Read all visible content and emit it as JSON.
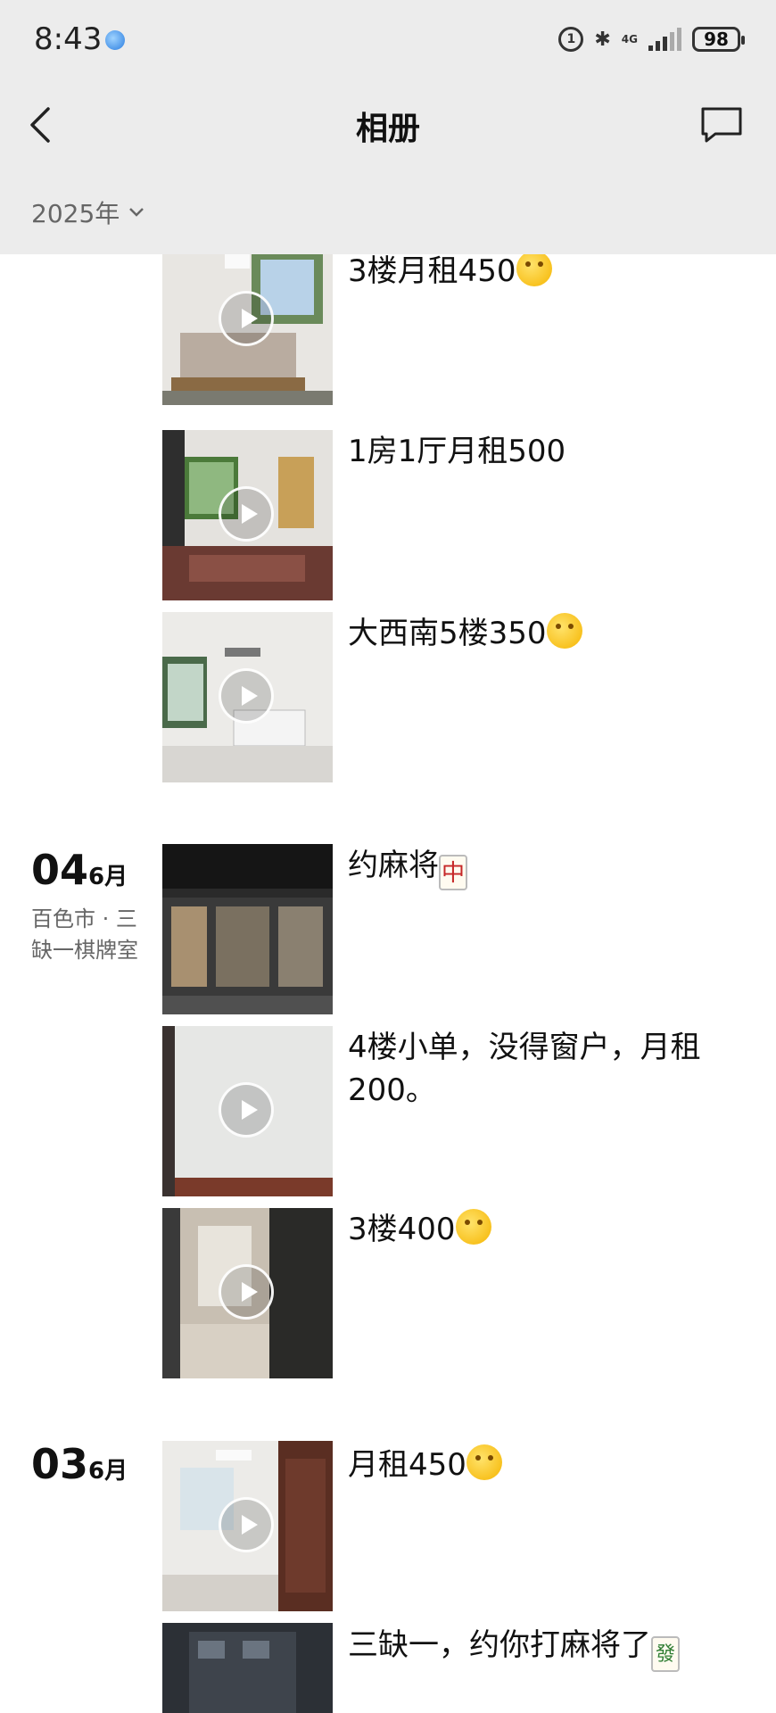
{
  "status_bar": {
    "time": "8:43",
    "battery": "98",
    "network": "4G"
  },
  "header": {
    "title": "相册",
    "year_filter": "2025年"
  },
  "groups": [
    {
      "posts": [
        {
          "text": "3楼月租450",
          "emoji": "smirk-emoji",
          "video": true
        },
        {
          "text": "1房1厅月租500",
          "video": true
        },
        {
          "text": "大西南5楼350",
          "emoji": "smirk-emoji",
          "video": true
        }
      ]
    },
    {
      "day": "04",
      "month": "6月",
      "location": "百色市 · 三缺一棋牌室",
      "posts": [
        {
          "text": "约麻将",
          "tile": "中",
          "video": false
        },
        {
          "text": "4楼小单，没得窗户，月租200。",
          "video": true
        },
        {
          "text": "3楼400",
          "emoji": "smirk-emoji",
          "video": true
        }
      ]
    },
    {
      "day": "03",
      "month": "6月",
      "posts": [
        {
          "text": "月租450",
          "emoji": "smirk-emoji",
          "video": true
        },
        {
          "text": "三缺一，约你打麻将了",
          "tile": "發",
          "video": false
        }
      ]
    }
  ],
  "colors": {
    "header_bg": "#ececec",
    "text": "#111111",
    "secondary": "#666666"
  }
}
